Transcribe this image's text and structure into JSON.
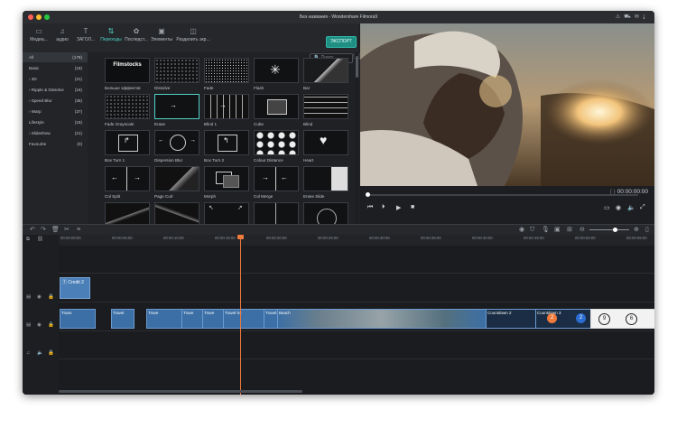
{
  "window": {
    "title": "Без названия - Wondershare Filmora9"
  },
  "tabs": [
    {
      "label": "Медиа...",
      "icon": "folder-icon"
    },
    {
      "label": "аудио",
      "icon": "music-note-icon"
    },
    {
      "label": "ЗАГОЛ...",
      "icon": "text-icon"
    },
    {
      "label": "Переходы",
      "icon": "transition-icon",
      "active": true
    },
    {
      "label": "Последст...",
      "icon": "effects-icon"
    },
    {
      "label": "Элементы",
      "icon": "image-icon"
    },
    {
      "label": "Разделить экр...",
      "icon": "split-screen-icon"
    }
  ],
  "export_label": "ЭКСПОРТ",
  "search_placeholder": "Поиск",
  "categories": [
    {
      "label": "All",
      "count": "(178)",
      "selected": true
    },
    {
      "label": "Basic",
      "count": "(18)"
    },
    {
      "label": "› 3D",
      "count": "(31)"
    },
    {
      "label": "› Ripple & Dissolve",
      "count": "(16)"
    },
    {
      "label": "› Speed Blur",
      "count": "(36)"
    },
    {
      "label": "› Warp",
      "count": "(37)"
    },
    {
      "label": "Lifestyle",
      "count": "(19)"
    },
    {
      "label": "› Slideshow",
      "count": "(21)"
    },
    {
      "label": "Favourite",
      "count": "(0)"
    }
  ],
  "transitions": [
    {
      "label": "Больше эффектов",
      "icon": "filmstocks-logo"
    },
    {
      "label": "Dissolve"
    },
    {
      "label": "Fade"
    },
    {
      "label": "Flash"
    },
    {
      "label": "Bar"
    },
    {
      "label": "Fade Grayscale"
    },
    {
      "label": "Erase",
      "selected": true
    },
    {
      "label": "Blind 1"
    },
    {
      "label": "Cube"
    },
    {
      "label": "Blind"
    },
    {
      "label": "Box Turn 1"
    },
    {
      "label": "Dispersion Blur"
    },
    {
      "label": "Box Turn 2"
    },
    {
      "label": "Colour Distance"
    },
    {
      "label": "Heart"
    },
    {
      "label": "Col Split"
    },
    {
      "label": "Page Curl"
    },
    {
      "label": "Morph"
    },
    {
      "label": "Col Merge"
    },
    {
      "label": "Erase Slide"
    }
  ],
  "filmstocks_label": "Filmstocks",
  "player": {
    "timecode": "00:00:00:00",
    "braces": "{ }"
  },
  "ruler": [
    "00:00:00:00",
    "00:00:05:00",
    "00:00:10:00",
    "00:00:15:00",
    "00:00:20:00",
    "00:00:25:00",
    "00:00:30:00",
    "00:00:35:00",
    "00:00:40:00",
    "00:00:45:00",
    "00:00:50:00",
    "00:00:55:00"
  ],
  "tracks": {
    "title_clip": "Credit 2",
    "clips": [
      "Trans",
      "Travel",
      "Trave",
      "Trave",
      "Trave",
      "Travel 04",
      "Travel",
      "Beach",
      "Countdown 2",
      "Countdown 3"
    ],
    "countdown_nums": [
      "2",
      "9",
      "6"
    ]
  },
  "colors": {
    "accent": "#4fd1c5",
    "playhead": "#f07a3c",
    "clip": "#3c6fa5"
  }
}
